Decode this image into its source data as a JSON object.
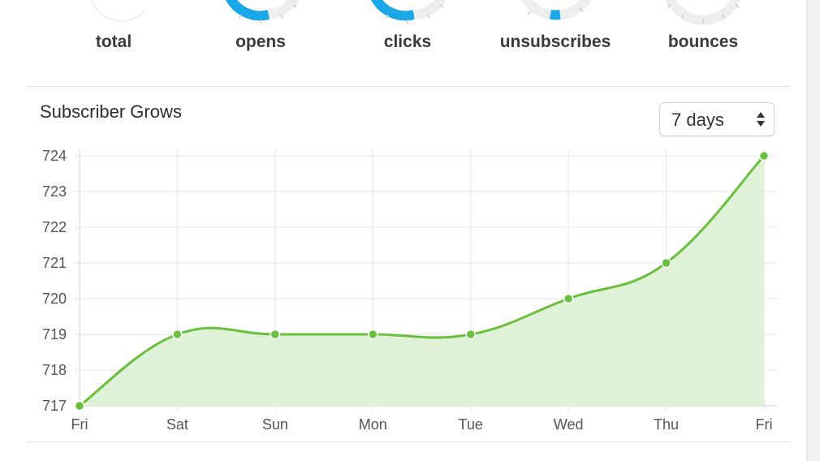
{
  "stats": {
    "labels": [
      "total",
      "opens",
      "clicks",
      "unsubscribes",
      "bounces"
    ]
  },
  "colors": {
    "gauge_fill": "#1aa7e8",
    "gauge_track": "#eeeeee",
    "line": "#6abf3f",
    "area": "#dff1d6",
    "grid": "#e6e6e6"
  },
  "section": {
    "title": "Subscriber Grows",
    "range_select": {
      "value": "7 days"
    }
  },
  "chart_data": {
    "type": "area",
    "categories": [
      "Fri",
      "Sat",
      "Sun",
      "Mon",
      "Tue",
      "Wed",
      "Thu",
      "Fri"
    ],
    "values": [
      717,
      719,
      719,
      719,
      719,
      720,
      721,
      724
    ],
    "ylim": [
      717,
      724
    ],
    "yticks": [
      724,
      723,
      722,
      721,
      720,
      719,
      718,
      717
    ],
    "grid": true,
    "title": "",
    "xlabel": "",
    "ylabel": ""
  }
}
